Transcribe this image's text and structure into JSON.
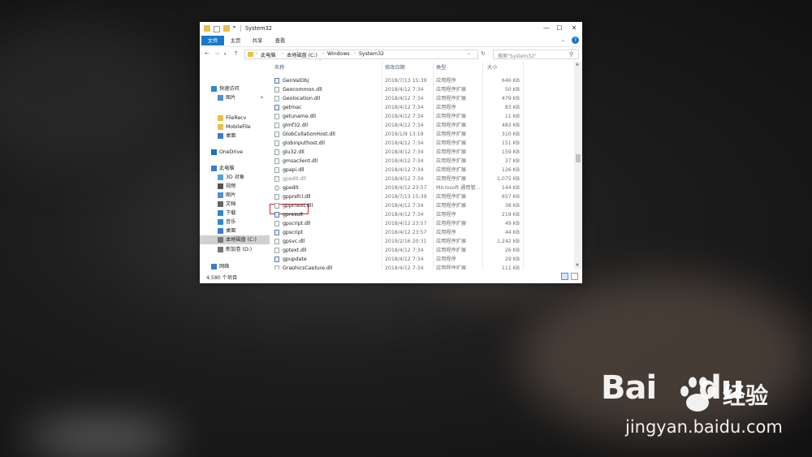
{
  "window": {
    "title": "System32",
    "controls": {
      "minimize": "—",
      "maximize": "☐",
      "close": "✕"
    }
  },
  "ribbon": {
    "tabs": [
      "文件",
      "主页",
      "共享",
      "查看"
    ],
    "help": "?"
  },
  "address": {
    "crumbs": [
      "此电脑",
      "本地磁盘 (C:)",
      "Windows",
      "System32"
    ],
    "search_placeholder": "搜索\"System32\""
  },
  "nav_pane": [
    {
      "label": "快速访问",
      "icon": "star-icon",
      "color": "#2b88d8"
    },
    {
      "label": "图片",
      "icon": "pictures-icon",
      "color": "#4a90d9",
      "pinned": true
    },
    {
      "label": "FileRecv",
      "icon": "folder-icon",
      "color": "#e8c04a"
    },
    {
      "label": "MobileFile",
      "icon": "folder-icon",
      "color": "#e8c04a"
    },
    {
      "label": "桌面",
      "icon": "desktop-icon",
      "color": "#3a7bd5"
    },
    {
      "label": "OneDrive",
      "icon": "cloud-icon",
      "color": "#1e6fc8"
    },
    {
      "label": "此电脑",
      "icon": "computer-icon",
      "color": "#3a7bd5"
    },
    {
      "label": "3D 对象",
      "icon": "cube-icon",
      "color": "#4aa3df"
    },
    {
      "label": "视频",
      "icon": "video-icon",
      "color": "#555555"
    },
    {
      "label": "图片",
      "icon": "pictures-icon",
      "color": "#4a90d9"
    },
    {
      "label": "文档",
      "icon": "document-icon",
      "color": "#666666"
    },
    {
      "label": "下载",
      "icon": "download-icon",
      "color": "#2b88d8"
    },
    {
      "label": "音乐",
      "icon": "music-icon",
      "color": "#2b88d8"
    },
    {
      "label": "桌面",
      "icon": "desktop-icon",
      "color": "#3a7bd5"
    },
    {
      "label": "本地磁盘 (C:)",
      "icon": "drive-icon",
      "color": "#777777",
      "selected": true
    },
    {
      "label": "新加卷 (D:)",
      "icon": "drive-icon",
      "color": "#777777"
    },
    {
      "label": "网络",
      "icon": "network-icon",
      "color": "#3a7bd5"
    }
  ],
  "columns": {
    "name": "名称",
    "date": "修改日期",
    "type": "类型",
    "size": "大小"
  },
  "files": [
    {
      "name": "GenValObj",
      "date": "2018/7/13 15:39",
      "type": "应用程序",
      "size": "646 KB",
      "kind": "exe"
    },
    {
      "name": "Geocommon.dll",
      "date": "2018/4/12 7:34",
      "type": "应用程序扩展",
      "size": "50 KB",
      "kind": "dll"
    },
    {
      "name": "Geolocation.dll",
      "date": "2018/4/12 7:34",
      "type": "应用程序扩展",
      "size": "479 KB",
      "kind": "dll"
    },
    {
      "name": "getmac",
      "date": "2018/4/12 7:34",
      "type": "应用程序",
      "size": "83 KB",
      "kind": "exe"
    },
    {
      "name": "getuname.dll",
      "date": "2018/4/12 7:34",
      "type": "应用程序扩展",
      "size": "11 KB",
      "kind": "dll"
    },
    {
      "name": "glmf32.dll",
      "date": "2018/4/12 7:34",
      "type": "应用程序扩展",
      "size": "483 KB",
      "kind": "dll"
    },
    {
      "name": "GlobCollationHost.dll",
      "date": "2019/1/9 13:19",
      "type": "应用程序扩展",
      "size": "310 KB",
      "kind": "dll"
    },
    {
      "name": "globinputhost.dll",
      "date": "2018/4/12 7:34",
      "type": "应用程序扩展",
      "size": "151 KB",
      "kind": "dll"
    },
    {
      "name": "glu32.dll",
      "date": "2018/4/12 7:34",
      "type": "应用程序扩展",
      "size": "159 KB",
      "kind": "dll"
    },
    {
      "name": "gmsaclient.dll",
      "date": "2018/4/12 7:34",
      "type": "应用程序扩展",
      "size": "37 KB",
      "kind": "dll"
    },
    {
      "name": "gpapi.dll",
      "date": "2018/4/12 7:34",
      "type": "应用程序扩展",
      "size": "126 KB",
      "kind": "dll"
    },
    {
      "name": "gpedit.dll",
      "date": "2018/4/12 7:34",
      "type": "应用程序扩展",
      "size": "1,075 KB",
      "kind": "dll",
      "faded": true
    },
    {
      "name": "gpedit",
      "date": "2018/4/12 23:57",
      "type": "Microsoft 通用管...",
      "size": "144 KB",
      "kind": "gear",
      "highlight": true
    },
    {
      "name": "gpprefcl.dll",
      "date": "2018/7/13 15:39",
      "type": "应用程序扩展",
      "size": "657 KB",
      "kind": "dll"
    },
    {
      "name": "gpprnext.dll",
      "date": "2018/4/12 7:34",
      "type": "应用程序扩展",
      "size": "38 KB",
      "kind": "dll"
    },
    {
      "name": "gpresult",
      "date": "2018/4/12 7:34",
      "type": "应用程序",
      "size": "219 KB",
      "kind": "exe"
    },
    {
      "name": "gpscript.dll",
      "date": "2018/4/12 23:57",
      "type": "应用程序扩展",
      "size": "49 KB",
      "kind": "dll"
    },
    {
      "name": "gpscript",
      "date": "2018/4/12 23:57",
      "type": "应用程序",
      "size": "44 KB",
      "kind": "exe"
    },
    {
      "name": "gpsvc.dll",
      "date": "2019/2/16 20:31",
      "type": "应用程序扩展",
      "size": "1,242 KB",
      "kind": "dll"
    },
    {
      "name": "gptext.dll",
      "date": "2018/4/12 7:34",
      "type": "应用程序扩展",
      "size": "26 KB",
      "kind": "dll"
    },
    {
      "name": "gpupdate",
      "date": "2018/4/12 7:34",
      "type": "应用程序",
      "size": "29 KB",
      "kind": "exe"
    },
    {
      "name": "GraphicsCapture.dll",
      "date": "2018/4/12 7:34",
      "type": "应用程序扩展",
      "size": "111 KB",
      "kind": "dll"
    }
  ],
  "status": {
    "item_count": "4,580 个项目"
  },
  "watermark": {
    "brand": "Bai",
    "brand2": "du",
    "cn": "经验",
    "url": "jingyan.baidu.com"
  },
  "colors": {
    "accent": "#1979ca",
    "highlight": "#d0262d",
    "folder": "#e8c04a"
  }
}
